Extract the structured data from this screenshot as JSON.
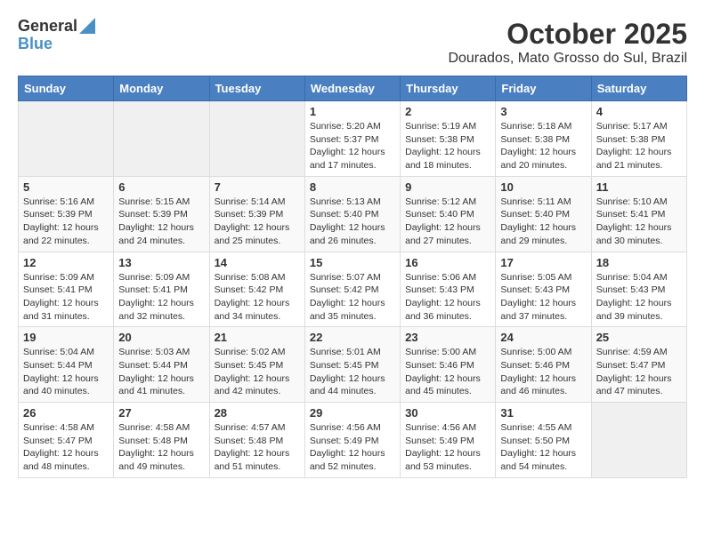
{
  "header": {
    "logo_general": "General",
    "logo_blue": "Blue",
    "month_title": "October 2025",
    "subtitle": "Dourados, Mato Grosso do Sul, Brazil"
  },
  "days_of_week": [
    "Sunday",
    "Monday",
    "Tuesday",
    "Wednesday",
    "Thursday",
    "Friday",
    "Saturday"
  ],
  "weeks": [
    [
      {
        "day": "",
        "info": ""
      },
      {
        "day": "",
        "info": ""
      },
      {
        "day": "",
        "info": ""
      },
      {
        "day": "1",
        "info": "Sunrise: 5:20 AM\nSunset: 5:37 PM\nDaylight: 12 hours\nand 17 minutes."
      },
      {
        "day": "2",
        "info": "Sunrise: 5:19 AM\nSunset: 5:38 PM\nDaylight: 12 hours\nand 18 minutes."
      },
      {
        "day": "3",
        "info": "Sunrise: 5:18 AM\nSunset: 5:38 PM\nDaylight: 12 hours\nand 20 minutes."
      },
      {
        "day": "4",
        "info": "Sunrise: 5:17 AM\nSunset: 5:38 PM\nDaylight: 12 hours\nand 21 minutes."
      }
    ],
    [
      {
        "day": "5",
        "info": "Sunrise: 5:16 AM\nSunset: 5:39 PM\nDaylight: 12 hours\nand 22 minutes."
      },
      {
        "day": "6",
        "info": "Sunrise: 5:15 AM\nSunset: 5:39 PM\nDaylight: 12 hours\nand 24 minutes."
      },
      {
        "day": "7",
        "info": "Sunrise: 5:14 AM\nSunset: 5:39 PM\nDaylight: 12 hours\nand 25 minutes."
      },
      {
        "day": "8",
        "info": "Sunrise: 5:13 AM\nSunset: 5:40 PM\nDaylight: 12 hours\nand 26 minutes."
      },
      {
        "day": "9",
        "info": "Sunrise: 5:12 AM\nSunset: 5:40 PM\nDaylight: 12 hours\nand 27 minutes."
      },
      {
        "day": "10",
        "info": "Sunrise: 5:11 AM\nSunset: 5:40 PM\nDaylight: 12 hours\nand 29 minutes."
      },
      {
        "day": "11",
        "info": "Sunrise: 5:10 AM\nSunset: 5:41 PM\nDaylight: 12 hours\nand 30 minutes."
      }
    ],
    [
      {
        "day": "12",
        "info": "Sunrise: 5:09 AM\nSunset: 5:41 PM\nDaylight: 12 hours\nand 31 minutes."
      },
      {
        "day": "13",
        "info": "Sunrise: 5:09 AM\nSunset: 5:41 PM\nDaylight: 12 hours\nand 32 minutes."
      },
      {
        "day": "14",
        "info": "Sunrise: 5:08 AM\nSunset: 5:42 PM\nDaylight: 12 hours\nand 34 minutes."
      },
      {
        "day": "15",
        "info": "Sunrise: 5:07 AM\nSunset: 5:42 PM\nDaylight: 12 hours\nand 35 minutes."
      },
      {
        "day": "16",
        "info": "Sunrise: 5:06 AM\nSunset: 5:43 PM\nDaylight: 12 hours\nand 36 minutes."
      },
      {
        "day": "17",
        "info": "Sunrise: 5:05 AM\nSunset: 5:43 PM\nDaylight: 12 hours\nand 37 minutes."
      },
      {
        "day": "18",
        "info": "Sunrise: 5:04 AM\nSunset: 5:43 PM\nDaylight: 12 hours\nand 39 minutes."
      }
    ],
    [
      {
        "day": "19",
        "info": "Sunrise: 5:04 AM\nSunset: 5:44 PM\nDaylight: 12 hours\nand 40 minutes."
      },
      {
        "day": "20",
        "info": "Sunrise: 5:03 AM\nSunset: 5:44 PM\nDaylight: 12 hours\nand 41 minutes."
      },
      {
        "day": "21",
        "info": "Sunrise: 5:02 AM\nSunset: 5:45 PM\nDaylight: 12 hours\nand 42 minutes."
      },
      {
        "day": "22",
        "info": "Sunrise: 5:01 AM\nSunset: 5:45 PM\nDaylight: 12 hours\nand 44 minutes."
      },
      {
        "day": "23",
        "info": "Sunrise: 5:00 AM\nSunset: 5:46 PM\nDaylight: 12 hours\nand 45 minutes."
      },
      {
        "day": "24",
        "info": "Sunrise: 5:00 AM\nSunset: 5:46 PM\nDaylight: 12 hours\nand 46 minutes."
      },
      {
        "day": "25",
        "info": "Sunrise: 4:59 AM\nSunset: 5:47 PM\nDaylight: 12 hours\nand 47 minutes."
      }
    ],
    [
      {
        "day": "26",
        "info": "Sunrise: 4:58 AM\nSunset: 5:47 PM\nDaylight: 12 hours\nand 48 minutes."
      },
      {
        "day": "27",
        "info": "Sunrise: 4:58 AM\nSunset: 5:48 PM\nDaylight: 12 hours\nand 49 minutes."
      },
      {
        "day": "28",
        "info": "Sunrise: 4:57 AM\nSunset: 5:48 PM\nDaylight: 12 hours\nand 51 minutes."
      },
      {
        "day": "29",
        "info": "Sunrise: 4:56 AM\nSunset: 5:49 PM\nDaylight: 12 hours\nand 52 minutes."
      },
      {
        "day": "30",
        "info": "Sunrise: 4:56 AM\nSunset: 5:49 PM\nDaylight: 12 hours\nand 53 minutes."
      },
      {
        "day": "31",
        "info": "Sunrise: 4:55 AM\nSunset: 5:50 PM\nDaylight: 12 hours\nand 54 minutes."
      },
      {
        "day": "",
        "info": ""
      }
    ]
  ]
}
